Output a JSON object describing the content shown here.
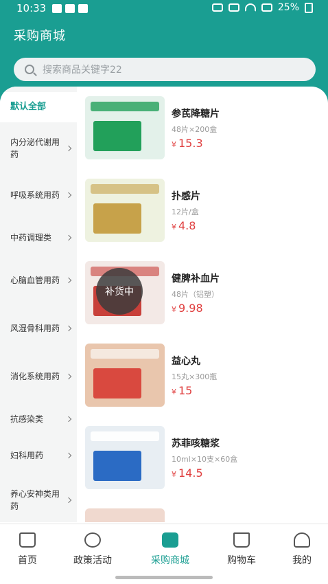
{
  "status_bar": {
    "time": "10:33",
    "battery": "25%"
  },
  "app_title": "采购商城",
  "search": {
    "placeholder": "搜索商品关键字22"
  },
  "sidebar": {
    "items": [
      {
        "label": "默认全部",
        "active": true
      },
      {
        "label": "内分泌代谢用药"
      },
      {
        "label": "呼吸系统用药"
      },
      {
        "label": "中药调理类"
      },
      {
        "label": "心脑血管用药"
      },
      {
        "label": "风湿骨科用药"
      },
      {
        "label": "消化系统用药"
      },
      {
        "label": "抗感染类"
      },
      {
        "label": "妇科用药"
      },
      {
        "label": "养心安神类用药"
      }
    ]
  },
  "products": [
    {
      "name": "参芪降糖片",
      "spec": "48片×200盒",
      "currency": "¥",
      "price": "15.3",
      "image_colors": [
        "#e3f1ea",
        "#22a05a"
      ]
    },
    {
      "name": "扑感片",
      "spec": "12片/盒",
      "currency": "¥",
      "price": "4.8",
      "image_colors": [
        "#eef2e0",
        "#c7a24a"
      ]
    },
    {
      "name": "健脾补血片",
      "spec": "48片（铝塑）",
      "currency": "¥",
      "price": "9.98",
      "restock_label": "补货中",
      "image_colors": [
        "#f3e9e6",
        "#c8403a"
      ]
    },
    {
      "name": "益心丸",
      "spec": "15丸×300瓶",
      "currency": "¥",
      "price": "15",
      "image_colors": [
        "#e9c6ad",
        "#d9493f"
      ]
    },
    {
      "name": "苏菲咳糖浆",
      "spec": "10ml×10支×60盒",
      "currency": "¥",
      "price": "14.5",
      "image_colors": [
        "#e8eef3",
        "#2b6bc4"
      ]
    }
  ],
  "tabbar": {
    "items": [
      {
        "label": "首页",
        "icon": "home-icon"
      },
      {
        "label": "政策活动",
        "icon": "star-icon"
      },
      {
        "label": "采购商城",
        "icon": "store-icon",
        "active": true
      },
      {
        "label": "购物车",
        "icon": "cart-icon"
      },
      {
        "label": "我的",
        "icon": "user-icon"
      }
    ]
  },
  "colors": {
    "brand": "#1a9e92",
    "price": "#e04040"
  }
}
